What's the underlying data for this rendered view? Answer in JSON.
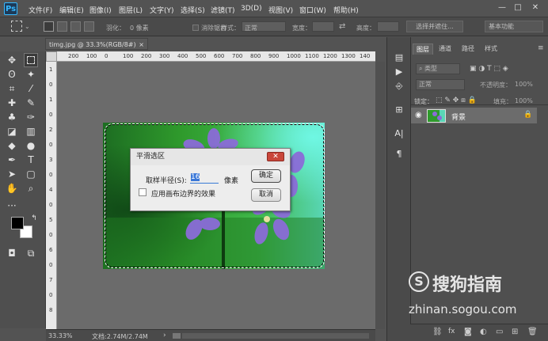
{
  "app": {
    "logo": "Ps"
  },
  "menu": [
    "文件(F)",
    "编辑(E)",
    "图像(I)",
    "图层(L)",
    "文字(Y)",
    "选择(S)",
    "滤镜(T)",
    "3D(D)",
    "视图(V)",
    "窗口(W)",
    "帮助(H)"
  ],
  "window_controls": {
    "minimize": "—",
    "maximize": "□",
    "close": "✕"
  },
  "options": {
    "feather_label": "羽化：",
    "feather_value": "0 像素",
    "antialias_label": "消除锯齿",
    "style_label": "样式：",
    "style_value": "正常",
    "width_label": "宽度：",
    "height_label": "高度：",
    "select_mask_button": "选择并遮住...",
    "workspace": "基本功能"
  },
  "document": {
    "tab_title": "timg.jpg @ 33.3%(RGB/8#)",
    "tab_close": "×"
  },
  "ruler": {
    "top_ticks": [
      "200",
      "100",
      "0",
      "100",
      "200",
      "300",
      "400",
      "500",
      "600",
      "700",
      "800",
      "900",
      "1000",
      "1100",
      "1200",
      "1300",
      "140"
    ],
    "left_ticks": [
      "1",
      "0",
      "1",
      "0",
      "2",
      "0",
      "3",
      "0",
      "4",
      "0",
      "5",
      "0",
      "6",
      "0",
      "7",
      "0",
      "8"
    ]
  },
  "status": {
    "zoom": "33.33%",
    "doc_info": "文档:2.74M/2.74M"
  },
  "layers_panel": {
    "tabs": [
      "图层",
      "通道",
      "路径",
      "样式"
    ],
    "filter_kind": "类型",
    "blend_mode": "正常",
    "opacity_label": "不透明度：",
    "opacity_value": "100%",
    "lock_label": "锁定：",
    "fill_label": "填充：",
    "fill_value": "100%",
    "layer_name": "背景",
    "bottom_icons": [
      "链接",
      "fx"
    ]
  },
  "dialog": {
    "title": "平滑选区",
    "close": "✕",
    "radius_label": "取样半径(S):",
    "radius_value": "16",
    "radius_unit": "像素",
    "checkbox_label": "应用画布边界的效果",
    "ok_button": "确定",
    "cancel_button": "取消"
  },
  "watermark": {
    "brand": "搜狗指南",
    "url": "zhinan.sogou.com",
    "logo_letter": "S"
  },
  "colors": {
    "accent": "#3b78d8",
    "close_red": "#c9463a",
    "ps_blue": "#35b8ff"
  }
}
